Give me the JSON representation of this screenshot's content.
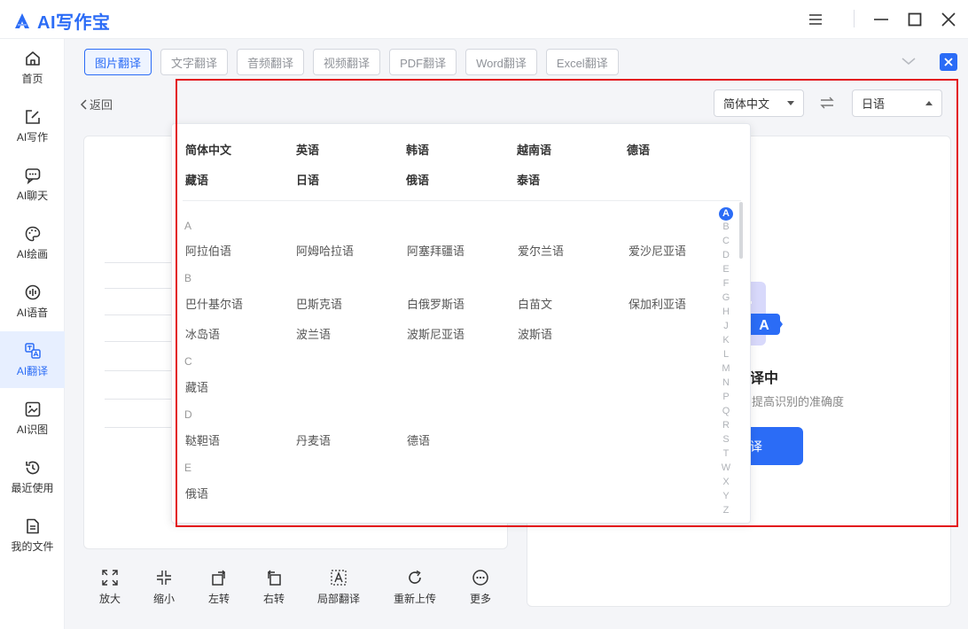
{
  "app": {
    "title": "AI写作宝"
  },
  "sidebar": {
    "items": [
      {
        "label": "首页",
        "icon": "home-icon"
      },
      {
        "label": "AI写作",
        "icon": "edit-icon"
      },
      {
        "label": "AI聊天",
        "icon": "chat-icon"
      },
      {
        "label": "AI绘画",
        "icon": "palette-icon"
      },
      {
        "label": "AI语音",
        "icon": "voice-icon"
      },
      {
        "label": "AI翻译",
        "icon": "translate-icon",
        "active": true
      },
      {
        "label": "AI识图",
        "icon": "image-recognize-icon"
      },
      {
        "label": "最近使用",
        "icon": "history-icon"
      },
      {
        "label": "我的文件",
        "icon": "file-icon"
      }
    ]
  },
  "tabs": [
    "图片翻译",
    "文字翻译",
    "音频翻译",
    "视频翻译",
    "PDF翻译",
    "Word翻译",
    "Excel翻译"
  ],
  "back_label": "返回",
  "source_lang": "简体中文",
  "target_lang": "日语",
  "dropdown": {
    "hot_langs": [
      "简体中文",
      "英语",
      "韩语",
      "越南语",
      "德语",
      "藏语",
      "日语",
      "俄语",
      "泰语"
    ],
    "groups": [
      {
        "letter": "A",
        "langs": [
          "阿拉伯语",
          "阿姆哈拉语",
          "阿塞拜疆语",
          "爱尔兰语",
          "爱沙尼亚语"
        ]
      },
      {
        "letter": "B",
        "langs": [
          "巴什基尔语",
          "巴斯克语",
          "白俄罗斯语",
          "白苗文",
          "保加利亚语",
          "冰岛语",
          "波兰语",
          "波斯尼亚语",
          "波斯语"
        ]
      },
      {
        "letter": "C",
        "langs": [
          "藏语"
        ]
      },
      {
        "letter": "D",
        "langs": [
          "鞑靼语",
          "丹麦语",
          "德语"
        ]
      },
      {
        "letter": "E",
        "langs": [
          "俄语"
        ]
      }
    ],
    "alphabet": [
      "A",
      "B",
      "C",
      "D",
      "E",
      "F",
      "G",
      "H",
      "J",
      "K",
      "L",
      "M",
      "N",
      "P",
      "Q",
      "R",
      "S",
      "T",
      "W",
      "X",
      "Y",
      "Z"
    ]
  },
  "right_panel": {
    "title_fragment": "译中",
    "subtitle_fragment": "提高识别的准确度",
    "button_fragment": "译"
  },
  "toolbar": [
    "放大",
    "缩小",
    "左转",
    "右转",
    "局部翻译",
    "重新上传",
    "更多"
  ],
  "colors": {
    "accent": "#2b6cf6",
    "highlight": "#e3131b"
  }
}
